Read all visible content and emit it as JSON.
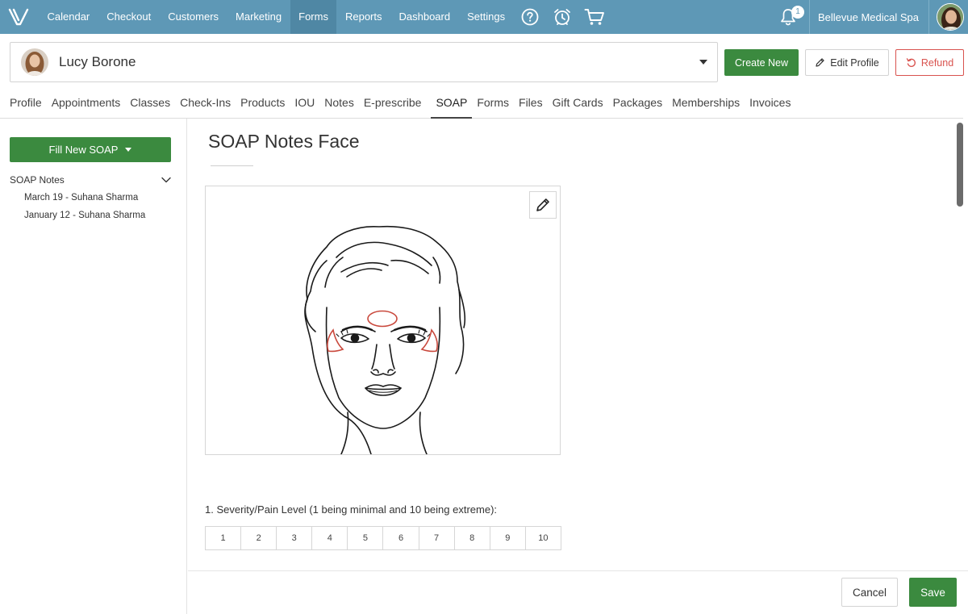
{
  "nav": {
    "links": [
      "Calendar",
      "Checkout",
      "Customers",
      "Marketing",
      "Forms",
      "Reports",
      "Dashboard",
      "Settings"
    ],
    "active": "Forms",
    "notification_count": "1",
    "business_name": "Bellevue Medical Spa"
  },
  "client": {
    "name": "Lucy Borone",
    "create_label": "Create New",
    "edit_label": "Edit Profile",
    "refund_label": "Refund"
  },
  "tabs": [
    "Profile",
    "Appointments",
    "Classes",
    "Check-Ins",
    "Products",
    "IOU",
    "Notes",
    "E-prescribe",
    "SOAP",
    "Forms",
    "Files",
    "Gift Cards",
    "Packages",
    "Memberships",
    "Invoices"
  ],
  "active_tab": "SOAP",
  "sidebar": {
    "fill_label": "Fill New SOAP",
    "section_label": "SOAP Notes",
    "items": [
      "March 19 - Suhana Sharma",
      "January 12 - Suhana Sharma"
    ]
  },
  "main": {
    "title": "SOAP Notes Face",
    "question": "1. Severity/Pain Level (1 being minimal and 10 being extreme):",
    "scale": [
      "1",
      "2",
      "3",
      "4",
      "5",
      "6",
      "7",
      "8",
      "9",
      "10"
    ]
  },
  "footer": {
    "cancel_label": "Cancel",
    "save_label": "Save"
  },
  "colors": {
    "nav_bg": "#5e98b6",
    "primary_green": "#3b8a3f",
    "danger_red": "#d9534f",
    "markup_red": "#c9483c"
  }
}
